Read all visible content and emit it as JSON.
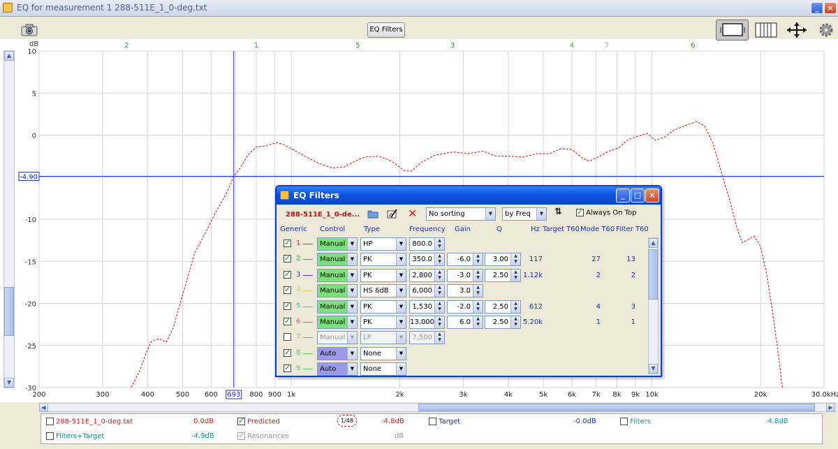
{
  "window": {
    "title": "EQ for measurement 1 288-511E_1_0-deg.txt"
  },
  "toolbar": {
    "eq_filters_label": "EQ Filters"
  },
  "graph": {
    "y_unit": "dB",
    "y_ticks": [
      "10",
      "5",
      "0",
      "-5",
      "-10",
      "-15",
      "-20",
      "-25",
      "-30"
    ],
    "x_ticks": [
      "200",
      "300",
      "400",
      "500",
      "600",
      "800",
      "900",
      "1k",
      "2k",
      "3k",
      "4k",
      "5k",
      "6k",
      "7k",
      "8k",
      "9k",
      "10k",
      "20k",
      "30.0kHz"
    ],
    "cursor_x_label": "693",
    "cursor_y_label": "-4.90",
    "filter_markers": [
      "2",
      "1",
      "5",
      "3",
      "4",
      "7",
      "6"
    ],
    "curve_color": "#e0302a",
    "cursor_color": "#1c2fd6"
  },
  "legend": {
    "measurement": {
      "name": "288-511E_1_0-deg.txt",
      "value": "0.0dB",
      "checked": false
    },
    "predicted": {
      "name": "Predicted",
      "value": "-4.8dB",
      "checked": true,
      "badge_left": "1/",
      "badge_right": "48"
    },
    "target": {
      "name": "Target",
      "value": "-0.0dB",
      "checked": false
    },
    "filters": {
      "name": "Filters",
      "value": "-4.8dB",
      "checked": false
    },
    "filters_target": {
      "name": "Filters+Target",
      "value": "-4.9dB",
      "checked": false
    },
    "resonances": {
      "name": "Resonances",
      "value": "dB",
      "checked": true
    }
  },
  "eq_dialog": {
    "title": "EQ Filters",
    "measurement_name": "288-511E_1_0-de...",
    "sorting": "No sorting",
    "sort_by": "by Freq",
    "always_on_top": "Always On Top",
    "headers": {
      "generic": "Generic",
      "control": "Control",
      "type": "Type",
      "frequency": "Frequency",
      "gain": "Gain",
      "q": "Q",
      "hz": "Hz",
      "target_t60": "Target T60",
      "mode_t60": "Mode T60",
      "filter_t60": "Filter T60"
    },
    "rows": [
      {
        "num": "1",
        "color": "#e0302a",
        "checked": true,
        "control": "Manual",
        "control_color": "#7ee07a",
        "type": "HP",
        "freq": "800.0",
        "gain": "",
        "q": "",
        "hz": "",
        "mode": "",
        "filter": ""
      },
      {
        "num": "2",
        "color": "#2fb82f",
        "checked": true,
        "control": "Manual",
        "control_color": "#7ee07a",
        "type": "PK",
        "freq": "350.0",
        "gain": "-6.0",
        "q": "3.00",
        "hz": "117",
        "mode": "27",
        "filter": "13"
      },
      {
        "num": "3",
        "color": "#4040d0",
        "checked": true,
        "control": "Manual",
        "control_color": "#7ee07a",
        "type": "PK",
        "freq": "2,800",
        "gain": "-3.0",
        "q": "2.50",
        "hz": "1.12k",
        "mode": "2",
        "filter": "2"
      },
      {
        "num": "4",
        "color": "#d8d040",
        "checked": true,
        "control": "Manual",
        "control_color": "#7ee07a",
        "type": "HS 6dB",
        "freq": "6,000",
        "gain": "3.0",
        "q": "",
        "hz": "",
        "mode": "",
        "filter": ""
      },
      {
        "num": "5",
        "color": "#40c8a0",
        "checked": true,
        "control": "Manual",
        "control_color": "#7ee07a",
        "type": "PK",
        "freq": "1,530",
        "gain": "-2.0",
        "q": "2.50",
        "hz": "612",
        "mode": "4",
        "filter": "3"
      },
      {
        "num": "6",
        "color": "#d050b0",
        "checked": true,
        "control": "Manual",
        "control_color": "#7ee07a",
        "type": "PK",
        "freq": "13,000",
        "gain": "6.0",
        "q": "2.50",
        "hz": "5.20k",
        "mode": "1",
        "filter": "1"
      },
      {
        "num": "7",
        "color": "#b08860",
        "checked": false,
        "control": "Manual",
        "control_color": "#e8e8e8",
        "type": "LP",
        "freq": "7,500",
        "gain": "",
        "q": "",
        "hz": "",
        "mode": "",
        "filter": ""
      },
      {
        "num": "8",
        "color": "#60d060",
        "checked": true,
        "control": "Auto",
        "control_color": "#9a9ae8",
        "type": "None",
        "freq": "",
        "gain": "",
        "q": "",
        "hz": "",
        "mode": "",
        "filter": ""
      },
      {
        "num": "9",
        "color": "#60d060",
        "checked": true,
        "control": "Auto",
        "control_color": "#9a9ae8",
        "type": "None",
        "freq": "",
        "gain": "",
        "q": "",
        "hz": "",
        "mode": "",
        "filter": ""
      }
    ]
  }
}
